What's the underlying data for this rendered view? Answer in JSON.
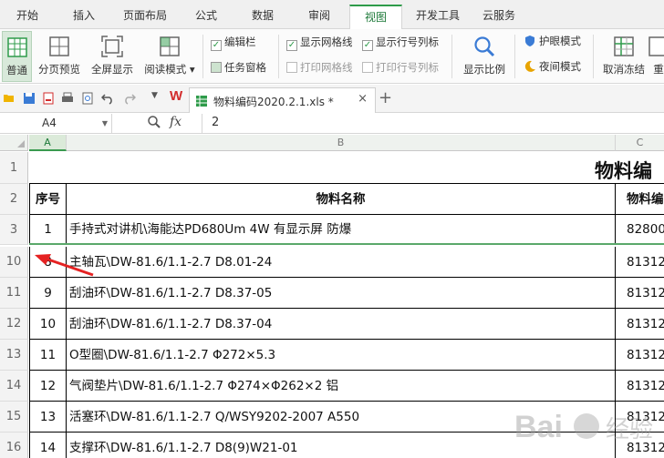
{
  "menu": {
    "tabs": [
      {
        "label": "开始"
      },
      {
        "label": "插入"
      },
      {
        "label": "页面布局"
      },
      {
        "label": "公式"
      },
      {
        "label": "数据"
      },
      {
        "label": "审阅"
      },
      {
        "label": "视图",
        "active": true
      },
      {
        "label": "开发工具"
      },
      {
        "label": "云服务"
      }
    ]
  },
  "ribbon": {
    "normal": "普通",
    "page_break": "分页预览",
    "fullscreen": "全屏显示",
    "reading_mode": "阅读模式",
    "edit_bar": "编辑栏",
    "task_pane": "任务窗格",
    "show_gridlines": "显示网格线",
    "show_row_col_headers": "显示行号列标",
    "print_gridlines": "打印网格线",
    "print_row_col_headers": "打印行号列标",
    "zoom": "显示比例",
    "eye_protection": "护眼模式",
    "night_mode": "夜间模式",
    "unfreeze": "取消冻结",
    "split": "重"
  },
  "doc_tab": {
    "title": "物料编码2020.2.1.xls *",
    "close": "×",
    "new": "+"
  },
  "formula_bar": {
    "name_box": "A4",
    "fx": "fx",
    "value": "2"
  },
  "columns": [
    "A",
    "B",
    "C"
  ],
  "sheet": {
    "title": "物料编",
    "header": {
      "no": "序号",
      "name": "物料名称",
      "code": "物料编"
    },
    "rows": [
      {
        "row": "3",
        "no": "1",
        "name": "手持式对讲机\\海能达PD680Um 4W 有显示屏 防爆",
        "code": "82800"
      },
      {
        "row": "10",
        "no": "8",
        "name": "主轴瓦\\DW-81.6/1.1-2.7 D8.01-24",
        "code": "81312"
      },
      {
        "row": "11",
        "no": "9",
        "name": "刮油环\\DW-81.6/1.1-2.7 D8.37-05",
        "code": "81312"
      },
      {
        "row": "12",
        "no": "10",
        "name": "刮油环\\DW-81.6/1.1-2.7 D8.37-04",
        "code": "81312"
      },
      {
        "row": "13",
        "no": "11",
        "name": "O型圈\\DW-81.6/1.1-2.7 Φ272×5.3",
        "code": "81312"
      },
      {
        "row": "14",
        "no": "12",
        "name": "气阀垫片\\DW-81.6/1.1-2.7 Φ274×Φ262×2 铝",
        "code": "81312"
      },
      {
        "row": "15",
        "no": "13",
        "name": "活塞环\\DW-81.6/1.1-2.7 Q/WSY9202-2007 A550",
        "code": "81312"
      },
      {
        "row": "16",
        "no": "14",
        "name": "支撑环\\DW-81.6/1.1-2.7 D8(9)W21-01",
        "code": "81312"
      }
    ],
    "row_header_1": "1",
    "row_header_2": "2"
  },
  "watermark": "Bai 经验",
  "colors": {
    "accent": "#2e9b4a",
    "wps_red": "#d22b2b"
  }
}
